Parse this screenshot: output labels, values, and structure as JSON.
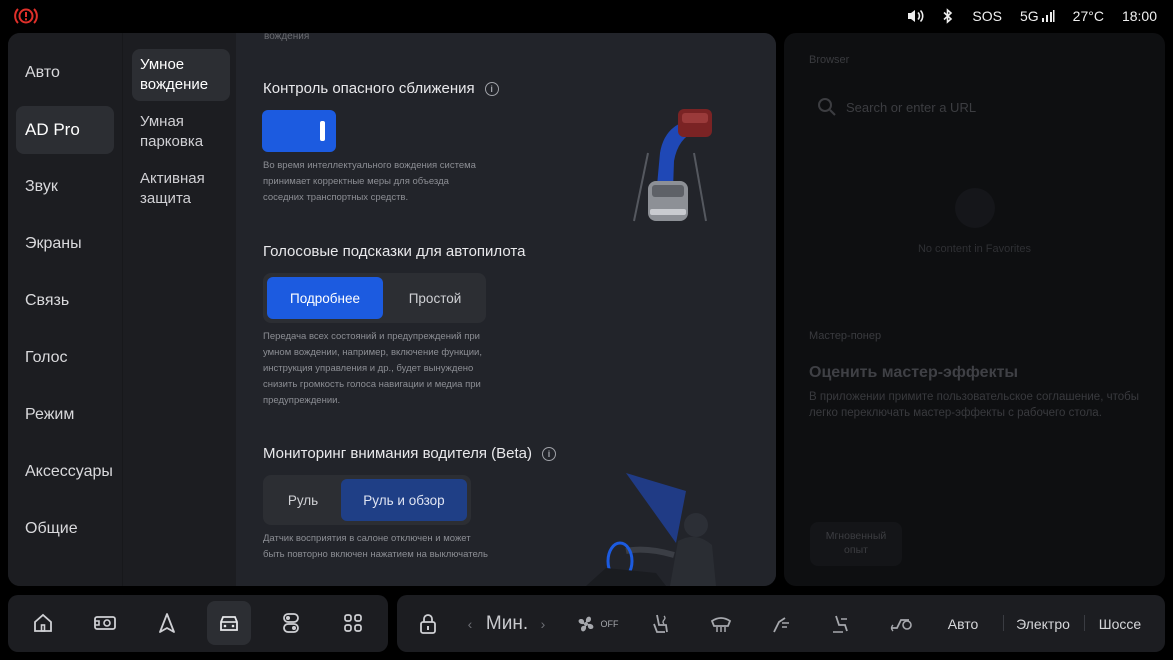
{
  "status_bar": {
    "volume_icon": "volume-icon",
    "bluetooth_icon": "bluetooth-icon",
    "sos": "SOS",
    "network": "5G",
    "temperature": "27°C",
    "time": "18:00",
    "brake_warning_color": "#e0302a"
  },
  "nav_primary": {
    "items": [
      {
        "label": "Авто"
      },
      {
        "label": "AD Pro"
      },
      {
        "label": "Звук"
      },
      {
        "label": "Экраны"
      },
      {
        "label": "Связь"
      },
      {
        "label": "Голос"
      },
      {
        "label": "Режим"
      },
      {
        "label": "Аксессуары"
      },
      {
        "label": "Общие"
      }
    ],
    "active_index": 1
  },
  "nav_secondary": {
    "items": [
      {
        "label": "Умное вождение"
      },
      {
        "label": "Умная парковка"
      },
      {
        "label": "Активная защита"
      }
    ],
    "active_index": 0
  },
  "content": {
    "faded_top": "вождения",
    "collision": {
      "title": "Контроль опасного сближения",
      "toggle_on": true,
      "description_lines": [
        "Во время интеллектуального вождения система",
        "принимает корректные меры для объезда",
        "соседних транспортных средств."
      ]
    },
    "voice": {
      "title": "Голосовые подсказки для автопилота",
      "options": [
        "Подробнее",
        "Простой"
      ],
      "selected": "Подробнее",
      "description_lines": [
        "Передача всех состояний и предупреждений при",
        "умном вождении, например, включение функции,",
        "инструкция управления и др., будет вынуждено",
        "снизить громкость голоса навигации и медиа при",
        "предупреждении."
      ]
    },
    "monitoring": {
      "title": "Мониторинг внимания водителя (Beta)",
      "options": [
        "Руль",
        "Руль и обзор"
      ],
      "selected": "Руль и обзор",
      "description_lines": [
        "Датчик восприятия в салоне отключен и может",
        "быть повторно включен нажатием на выключатель"
      ]
    },
    "accent_color": "#1c5be0"
  },
  "browser": {
    "label": "Browser",
    "search_placeholder": "Search or enter a URL",
    "empty_text": "No content in Favorites",
    "master_label": "Мастер-понер",
    "heading": "Оценить мастер-эффекты",
    "description": "В приложении примите пользовательское соглашение, чтобы легко переключать мастер-эффекты с рабочего стола.",
    "instant_label": "Мгновенный опыт"
  },
  "dock": {
    "apps": [
      "home-icon",
      "media-icon",
      "navigation-icon",
      "car-icon",
      "switch-icon",
      "apps-grid-icon"
    ],
    "active_index": 3
  },
  "climate": {
    "fan_level": "Мин.",
    "fan_state": "OFF",
    "modes": [
      "Авто",
      "Электро",
      "Шоссе"
    ]
  }
}
